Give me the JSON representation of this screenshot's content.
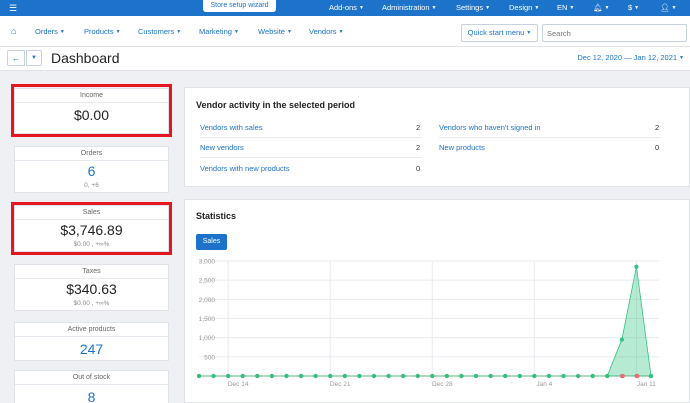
{
  "topbar": {
    "wizard_label": "Store setup wizard",
    "items": [
      {
        "label": "Add-ons"
      },
      {
        "label": "Administration"
      },
      {
        "label": "Settings"
      },
      {
        "label": "Design"
      },
      {
        "label": "EN"
      },
      {
        "label": "$"
      }
    ]
  },
  "nav": {
    "items": [
      {
        "label": "Orders"
      },
      {
        "label": "Products"
      },
      {
        "label": "Customers"
      },
      {
        "label": "Marketing"
      },
      {
        "label": "Website"
      },
      {
        "label": "Vendors"
      }
    ],
    "quick_start_label": "Quick start menu",
    "search_placeholder": "Search"
  },
  "page": {
    "title": "Dashboard",
    "date_range": "Dec 12, 2020 — Jan 12, 2021"
  },
  "stats": {
    "income": {
      "label": "Income",
      "value": "$0.00"
    },
    "orders": {
      "label": "Orders",
      "value": "6",
      "sub": "0, +6"
    },
    "sales": {
      "label": "Sales",
      "value": "$3,746.89",
      "sub": "$0.00 , +∞%"
    },
    "taxes": {
      "label": "Taxes",
      "value": "$340.63",
      "sub": "$0.00 , +∞%"
    },
    "active_products": {
      "label": "Active products",
      "value": "247"
    },
    "out_of_stock": {
      "label": "Out of stock",
      "value": "8"
    }
  },
  "vendor_activity": {
    "title": "Vendor activity in the selected period",
    "left": [
      {
        "label": "Vendors with sales",
        "value": "2"
      },
      {
        "label": "New vendors",
        "value": "2"
      },
      {
        "label": "Vendors with new products",
        "value": "0"
      }
    ],
    "right": [
      {
        "label": "Vendors who haven't signed in",
        "value": "2"
      },
      {
        "label": "New products",
        "value": "0"
      }
    ]
  },
  "statistics": {
    "title": "Statistics",
    "tab_label": "Sales"
  },
  "chart_data": {
    "type": "area",
    "x_ticks": [
      "Dec 14",
      "Dec 21",
      "Dec 28",
      "Jan 4",
      "Jan 11"
    ],
    "x_tick_index": [
      2,
      9,
      16,
      23,
      30
    ],
    "ylim": [
      0,
      3000
    ],
    "y_ticks": [
      500,
      1000,
      1500,
      2000,
      2500,
      3000
    ],
    "y_tick_labels": [
      "500",
      "1,000",
      "1,500",
      "2,000",
      "2,500",
      "3,000"
    ],
    "grid": true,
    "series": [
      {
        "color": "#2ec27e",
        "values": [
          0,
          0,
          0,
          0,
          0,
          0,
          0,
          0,
          0,
          0,
          0,
          0,
          0,
          0,
          0,
          0,
          0,
          0,
          0,
          0,
          0,
          0,
          0,
          0,
          0,
          0,
          0,
          0,
          0,
          950,
          2850,
          0
        ]
      },
      {
        "color": "#f06a7a",
        "values": [
          0,
          0,
          0,
          0,
          0,
          0,
          0,
          0,
          0,
          0,
          0,
          0,
          0,
          0,
          0,
          0,
          0,
          0,
          0,
          0,
          0,
          0,
          0,
          0,
          0,
          0,
          0,
          0,
          0,
          0,
          0,
          0
        ]
      }
    ]
  }
}
